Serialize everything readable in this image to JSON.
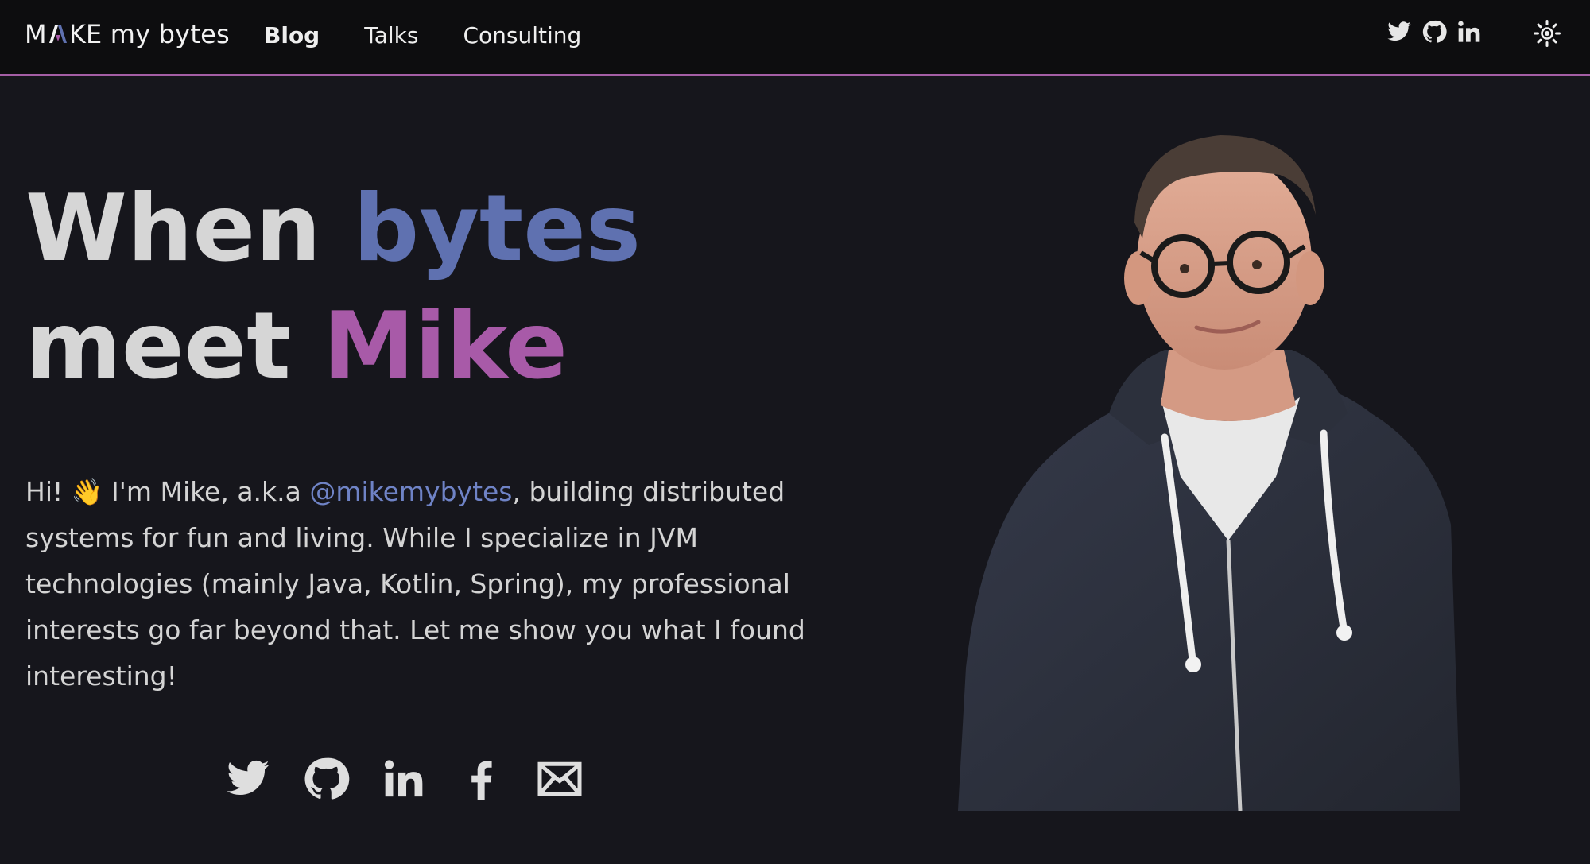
{
  "nav": {
    "logo_prefix": "M",
    "logo_suffix": "KE my bytes",
    "links": [
      {
        "label": "Blog",
        "active": true
      },
      {
        "label": "Talks",
        "active": false
      },
      {
        "label": "Consulting",
        "active": false
      }
    ],
    "social_icons": [
      "twitter-icon",
      "github-icon",
      "linkedin-icon"
    ],
    "theme_icon": "sun-icon"
  },
  "hero": {
    "line1_a": "When ",
    "line1_b": "bytes",
    "line2_a": "meet ",
    "line2_b": "Mike"
  },
  "bio": {
    "greeting": "Hi! ",
    "wave": "👋",
    "intro": " I'm Mike, a.k.a ",
    "handle": "@mikemybytes",
    "rest": ", building distributed systems for fun and living. While I specialize in JVM technologies (mainly Java, Kotlin, Spring), my professional interests go far beyond that. Let me show you what I found interesting!"
  },
  "social_row": [
    "twitter-icon",
    "github-icon",
    "linkedin-icon",
    "facebook-icon",
    "mail-icon"
  ],
  "colors": {
    "background": "#16161c",
    "navbar": "#0d0d0f",
    "nav_border": "#a45ea5",
    "accent_blue": "#5f71b0",
    "accent_purple": "#a85aa8",
    "link": "#6f83c6"
  }
}
